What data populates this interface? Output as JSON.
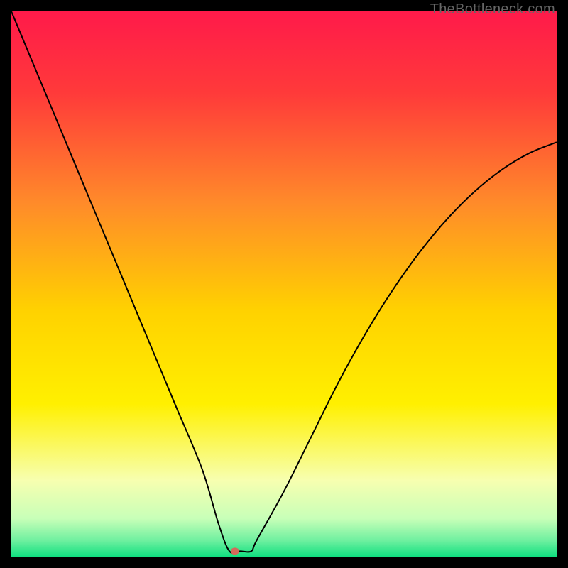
{
  "watermark": "TheBottleneck.com",
  "chart_data": {
    "type": "line",
    "title": "",
    "xlabel": "",
    "ylabel": "",
    "xlim": [
      0,
      100
    ],
    "ylim": [
      0,
      100
    ],
    "background_gradient": {
      "stops": [
        {
          "offset": 0.0,
          "color": "#ff1a4a"
        },
        {
          "offset": 0.15,
          "color": "#ff3a3a"
        },
        {
          "offset": 0.35,
          "color": "#ff8a2a"
        },
        {
          "offset": 0.55,
          "color": "#ffd200"
        },
        {
          "offset": 0.72,
          "color": "#fff000"
        },
        {
          "offset": 0.86,
          "color": "#f7ffb0"
        },
        {
          "offset": 0.93,
          "color": "#c8ffb8"
        },
        {
          "offset": 0.97,
          "color": "#70f0a0"
        },
        {
          "offset": 1.0,
          "color": "#10e080"
        }
      ]
    },
    "series": [
      {
        "name": "bottleneck-curve",
        "color": "#000000",
        "width": 2,
        "x": [
          0,
          5,
          10,
          15,
          20,
          25,
          30,
          35,
          38,
          40,
          42,
          44,
          45,
          50,
          55,
          60,
          65,
          70,
          75,
          80,
          85,
          90,
          95,
          100
        ],
        "values": [
          100,
          88,
          76,
          64,
          52,
          40,
          28,
          16,
          6,
          1,
          1,
          1,
          3,
          12,
          22,
          32,
          41,
          49,
          56,
          62,
          67,
          71,
          74,
          76
        ]
      }
    ],
    "marker": {
      "name": "minimum-marker",
      "x": 41,
      "y": 1,
      "color": "#d46a5a",
      "rx": 6,
      "ry": 5
    }
  }
}
